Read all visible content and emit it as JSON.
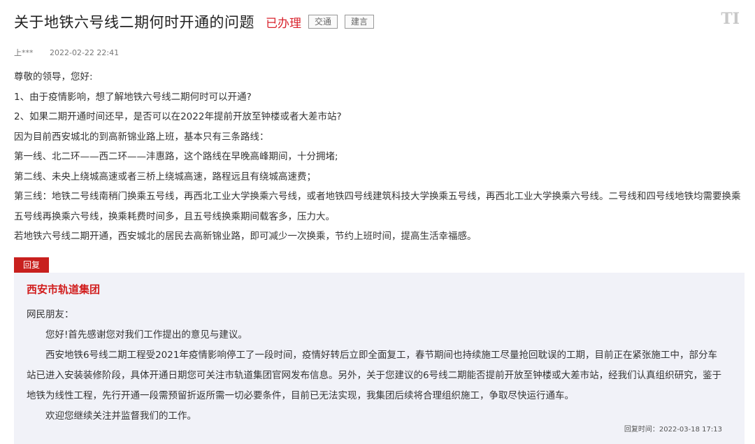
{
  "header": {
    "title": "关于地铁六号线二期何时开通的问题",
    "status": "已办理",
    "tags": [
      "交通",
      "建言"
    ],
    "font_toggle": "TI"
  },
  "meta": {
    "author": "上***",
    "datetime": "2022-02-22 22:41"
  },
  "message": {
    "lines": [
      "尊敬的领导，您好:",
      "1、由于疫情影响，想了解地铁六号线二期何时可以开通?",
      "2、如果二期开通时间还早，是否可以在2022年提前开放至钟楼或者大差市站?",
      "因为目前西安城北的到高新锦业路上班，基本只有三条路线：",
      "第一线、北二环——西二环——沣惠路，这个路线在早晚高峰期间，十分拥堵;",
      "第二线、未央上绕城高速或者三桥上绕城高速，路程远且有绕城高速费；",
      "第三线：地铁二号线南稍门换乘五号线，再西北工业大学换乘六号线，或者地铁四号线建筑科技大学换乘五号线，再西北工业大学换乘六号线。二号线和四号线地铁均需要换乘五号线再换乘六号线，换乘耗费时间多，且五号线换乘期间载客多，压力大。",
      "若地铁六号线二期开通，西安城北的居民去高新锦业路，即可减少一次换乘，节约上班时间，提高生活幸福感。"
    ]
  },
  "reply": {
    "tab_label": "回复",
    "org": "西安市轨道集团",
    "greeting": "网民朋友：",
    "paragraphs": [
      "您好!首先感谢您对我们工作提出的意见与建议。",
      "西安地铁6号线二期工程受2021年疫情影响停工了一段时间，疫情好转后立即全面复工，春节期间也持续施工尽量抢回耽误的工期，目前正在紧张施工中，部分车站已进入安装装修阶段，具体开通日期您可关注市轨道集团官网发布信息。另外，关于您建议的6号线二期能否提前开放至钟楼或大差市站，经我们认真组织研究，鉴于地铁为线性工程，先行开通一段需预留折返所需一切必要条件，目前已无法实现，我集团后续将合理组织施工，争取尽快运行通车。",
      "欢迎您继续关注并监督我们的工作。"
    ],
    "time": "回复时间：2022-03-18 17:13"
  },
  "colors": {
    "accent_red": "#d11d1d",
    "reply_bg": "#f1f2f8"
  }
}
